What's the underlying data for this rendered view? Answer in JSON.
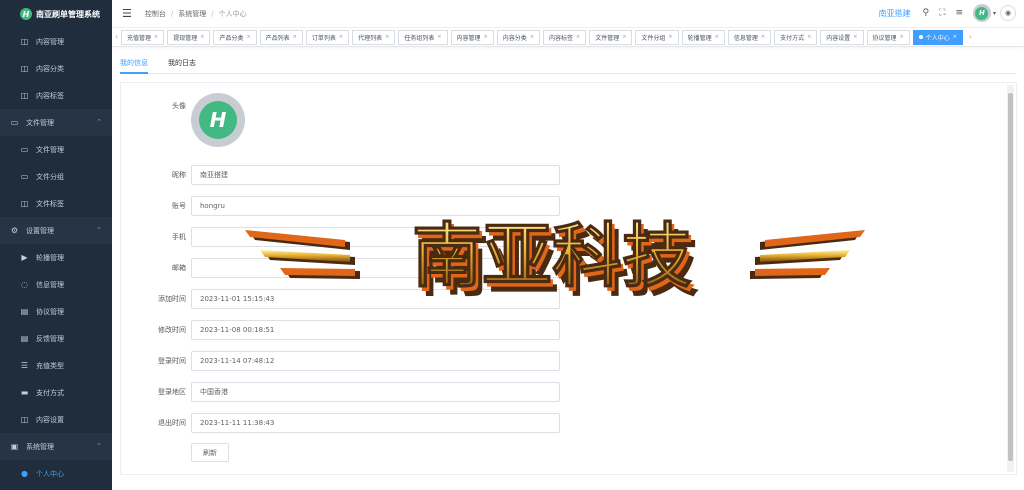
{
  "sidebar": {
    "brand_logo_letter": "H",
    "brand_title": "南亚刷单管理系统",
    "items": [
      {
        "label": "内容管理",
        "icon": "book-icon",
        "kind": "sub"
      },
      {
        "label": "内容分类",
        "icon": "book-icon",
        "kind": "sub"
      },
      {
        "label": "内容标签",
        "icon": "book-icon",
        "kind": "sub"
      },
      {
        "label": "文件管理",
        "icon": "folder-icon",
        "kind": "group"
      },
      {
        "label": "文件管理",
        "icon": "folder-icon",
        "kind": "sub"
      },
      {
        "label": "文件分组",
        "icon": "folder-icon",
        "kind": "sub"
      },
      {
        "label": "文件标签",
        "icon": "book-icon",
        "kind": "sub"
      },
      {
        "label": "设置管理",
        "icon": "gear-icon",
        "kind": "group"
      },
      {
        "label": "轮播管理",
        "icon": "play-icon",
        "kind": "sub"
      },
      {
        "label": "信息管理",
        "icon": "chat-icon",
        "kind": "sub"
      },
      {
        "label": "协议管理",
        "icon": "document-icon",
        "kind": "sub"
      },
      {
        "label": "反馈管理",
        "icon": "document-icon",
        "kind": "sub"
      },
      {
        "label": "充值类型",
        "icon": "list-icon",
        "kind": "sub"
      },
      {
        "label": "支付方式",
        "icon": "monitor-icon",
        "kind": "sub"
      },
      {
        "label": "内容设置",
        "icon": "book-icon",
        "kind": "sub"
      },
      {
        "label": "系统管理",
        "icon": "system-icon",
        "kind": "group"
      },
      {
        "label": "个人中心",
        "icon": "user-icon",
        "kind": "active"
      }
    ]
  },
  "header": {
    "breadcrumb": [
      "控制台",
      "系统管理",
      "个人中心"
    ],
    "site_link": "南亚搭建",
    "avatar_letter": "H"
  },
  "tags": [
    {
      "label": "充值管理",
      "active": false
    },
    {
      "label": "提现管理",
      "active": false
    },
    {
      "label": "产品分类",
      "active": false
    },
    {
      "label": "产品列表",
      "active": false
    },
    {
      "label": "订单列表",
      "active": false
    },
    {
      "label": "代理列表",
      "active": false
    },
    {
      "label": "任务组列表",
      "active": false
    },
    {
      "label": "内容管理",
      "active": false
    },
    {
      "label": "内容分类",
      "active": false
    },
    {
      "label": "内容标签",
      "active": false
    },
    {
      "label": "文件管理",
      "active": false
    },
    {
      "label": "文件分组",
      "active": false
    },
    {
      "label": "轮播管理",
      "active": false
    },
    {
      "label": "信息管理",
      "active": false
    },
    {
      "label": "支付方式",
      "active": false
    },
    {
      "label": "内容设置",
      "active": false
    },
    {
      "label": "协议管理",
      "active": false
    },
    {
      "label": "个人中心",
      "active": true
    }
  ],
  "content_tabs": [
    "我的信息",
    "我的日志"
  ],
  "form": {
    "avatar_label": "头像",
    "avatar_letter": "H",
    "fields": [
      {
        "label": "昵称",
        "value": ""
      },
      {
        "label": "账号",
        "value": "hongru"
      },
      {
        "label": "手机",
        "value": ""
      },
      {
        "label": "邮箱",
        "value": ""
      },
      {
        "label": "添加时间",
        "value": "2023-11-01 15:15:43"
      },
      {
        "label": "修改时间",
        "value": "2023-11-08 00:18:51"
      },
      {
        "label": "登录时间",
        "value": "2023-11-14 07:48:12"
      },
      {
        "label": "登录地区",
        "value": "中国香港"
      },
      {
        "label": "退出时间",
        "value": "2023-11-11 11:38:43"
      }
    ],
    "nickname_value": "南亚搭建",
    "refresh_label": "刷新"
  },
  "watermark": {
    "text": "南亚科技",
    "gold": "#e8b030",
    "orange": "#e0661a",
    "dark": "#4a2a10"
  }
}
